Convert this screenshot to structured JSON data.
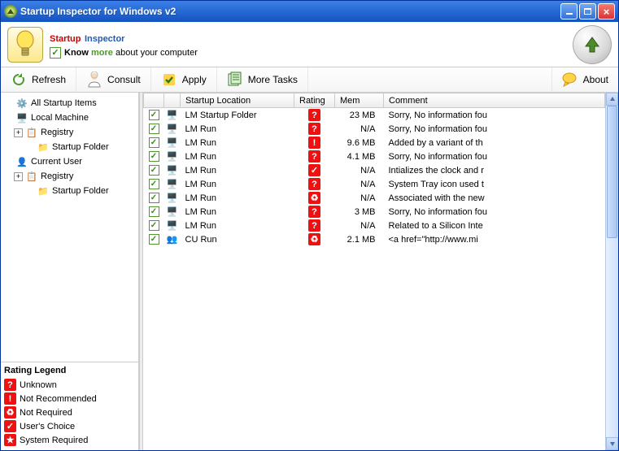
{
  "window": {
    "title": "Startup Inspector for Windows v2"
  },
  "header": {
    "brand1": "Startup",
    "brand2": "Inspector",
    "tagline_know": "Know",
    "tagline_more": "more",
    "tagline_rest": "about your computer"
  },
  "toolbar": {
    "refresh": "Refresh",
    "consult": "Consult",
    "apply": "Apply",
    "more_tasks": "More Tasks",
    "about": "About"
  },
  "tree": {
    "all_startup": "All Startup Items",
    "local_machine": "Local Machine",
    "registry": "Registry",
    "startup_folder": "Startup Folder",
    "current_user": "Current User"
  },
  "legend": {
    "title": "Rating Legend",
    "unknown": "Unknown",
    "not_recommended": "Not Recommended",
    "not_required": "Not Required",
    "users_choice": "User's Choice",
    "system_required": "System Required"
  },
  "columns": {
    "location": "Startup Location",
    "rating": "Rating",
    "mem": "Mem",
    "comment": "Comment"
  },
  "rows": [
    {
      "icon": "lm",
      "loc": "LM Startup Folder",
      "rating": "unknown",
      "mem": "23 MB",
      "comment": "Sorry, No information fou"
    },
    {
      "icon": "lm",
      "loc": "LM Run",
      "rating": "unknown",
      "mem": "N/A",
      "comment": "Sorry, No information fou"
    },
    {
      "icon": "lm",
      "loc": "LM Run",
      "rating": "notrec",
      "mem": "9.6 MB",
      "comment": "Added by a variant of th"
    },
    {
      "icon": "lm",
      "loc": "LM Run",
      "rating": "unknown",
      "mem": "4.1 MB",
      "comment": "Sorry, No information fou"
    },
    {
      "icon": "lm",
      "loc": "LM Run",
      "rating": "choice",
      "mem": "N/A",
      "comment": "Intializes the clock and r"
    },
    {
      "icon": "lm",
      "loc": "LM Run",
      "rating": "unknown",
      "mem": "N/A",
      "comment": "System Tray icon used t"
    },
    {
      "icon": "lm",
      "loc": "LM Run",
      "rating": "notreq",
      "mem": "N/A",
      "comment": "Associated with the new"
    },
    {
      "icon": "lm",
      "loc": "LM Run",
      "rating": "unknown",
      "mem": "3 MB",
      "comment": "Sorry, No information fou"
    },
    {
      "icon": "lm",
      "loc": "LM Run",
      "rating": "unknown",
      "mem": "N/A",
      "comment": "Related to a Silicon Inte"
    },
    {
      "icon": "cu",
      "loc": "CU Run",
      "rating": "notreq",
      "mem": "2.1 MB",
      "comment": "<a href=\"http://www.mi"
    }
  ]
}
